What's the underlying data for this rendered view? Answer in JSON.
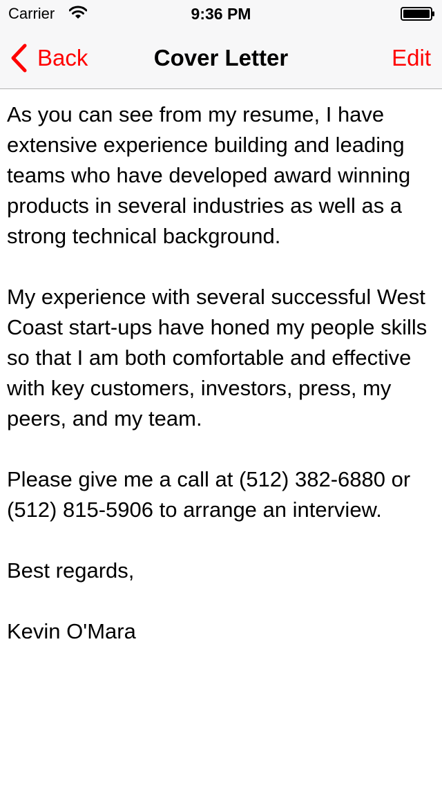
{
  "status_bar": {
    "carrier": "Carrier",
    "time": "9:36 PM",
    "wifi_icon": "wifi-icon",
    "battery_icon": "battery-icon"
  },
  "nav": {
    "back_label": "Back",
    "title": "Cover Letter",
    "edit_label": "Edit",
    "accent_color": "#ff0000"
  },
  "letter": {
    "paragraphs": [
      "As you can see from my resume, I have extensive experience building and leading teams who have developed award winning products in several industries as well as a strong technical background.",
      "My experience with several successful West Coast start-ups have honed my people skills so that I am both comfortable and effective with key customers, investors, press, my peers, and my team.",
      "Please give me a call at (512) 382-6880 or (512) 815-5906 to arrange an interview.",
      "Best regards,",
      "Kevin O'Mara"
    ]
  }
}
